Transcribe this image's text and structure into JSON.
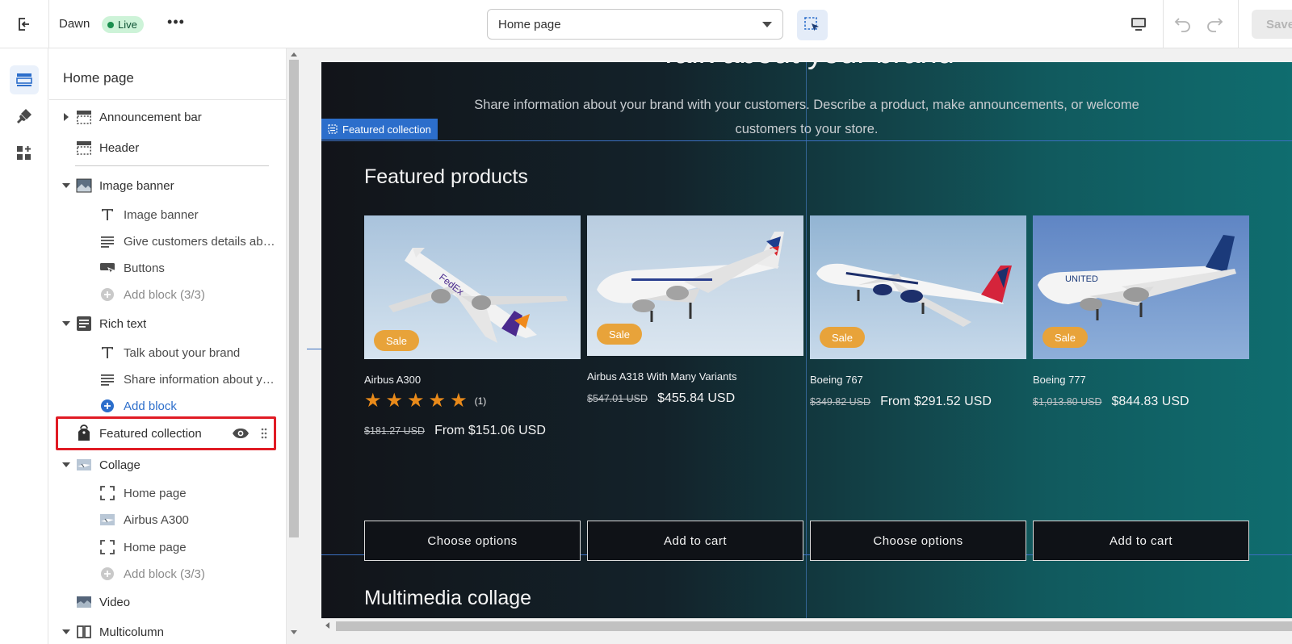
{
  "topbar": {
    "theme_name": "Dawn",
    "live_label": "Live",
    "more_label": "•••",
    "page_select": "Home page",
    "save_label": "Save"
  },
  "sidebar": {
    "title": "Home page",
    "items": [
      {
        "label": "Announcement bar",
        "icon": "announcement-bar-icon"
      },
      {
        "label": "Header",
        "icon": "header-icon"
      },
      {
        "label": "Image banner",
        "icon": "image-banner-icon"
      },
      {
        "label": "Image banner",
        "icon": "text-icon"
      },
      {
        "label": "Give customers details about the banner image(s) or content on the template.",
        "icon": "paragraph-icon"
      },
      {
        "label": "Buttons",
        "icon": "buttons-icon"
      },
      {
        "label": "Add block (3/3)",
        "icon": "add-circle-icon"
      },
      {
        "label": "Rich text",
        "icon": "rich-text-icon"
      },
      {
        "label": "Talk about your brand",
        "icon": "text-icon"
      },
      {
        "label": "Share information about your brand with your customers.",
        "icon": "paragraph-icon"
      },
      {
        "label": "Add block",
        "icon": "add-circle-icon"
      },
      {
        "label": "Featured collection",
        "icon": "tag-icon"
      },
      {
        "label": "Collage",
        "icon": "collage-icon"
      },
      {
        "label": "Home page",
        "icon": "frame-icon"
      },
      {
        "label": "Airbus A300",
        "icon": "product-thumb-icon"
      },
      {
        "label": "Home page",
        "icon": "frame-icon"
      },
      {
        "label": "Add block (3/3)",
        "icon": "add-circle-icon"
      },
      {
        "label": "Video",
        "icon": "video-icon"
      },
      {
        "label": "Multicolumn",
        "icon": "multicolumn-icon"
      }
    ]
  },
  "preview": {
    "brand_heading": "Talk about your brand",
    "brand_text": "Share information about your brand with your customers. Describe a product, make announcements, or welcome customers to your store.",
    "section_label": "Featured collection",
    "featured_title": "Featured products",
    "multimedia_title": "Multimedia collage",
    "products": [
      {
        "name": "Airbus A300",
        "sale": "Sale",
        "stars": "★",
        "review_count": "(1)",
        "old_price": "$181.27 USD",
        "new_price": "From $151.06 USD",
        "button": "Choose options"
      },
      {
        "name": "Airbus A318 With Many Variants",
        "sale": "Sale",
        "old_price": "$547.01 USD",
        "new_price": "$455.84 USD",
        "button": "Add to cart"
      },
      {
        "name": "Boeing 767",
        "sale": "Sale",
        "old_price": "$349.82 USD",
        "new_price": "From $291.52 USD",
        "button": "Choose options"
      },
      {
        "name": "Boeing 777",
        "sale": "Sale",
        "old_price": "$1,013.80 USD",
        "new_price": "$844.83 USD",
        "button": "Add to cart"
      }
    ]
  },
  "colors": {
    "accent": "#2c6ecb",
    "selection_outline": "#e01b24",
    "sale_badge": "#e8a33a",
    "star": "#e98a1a"
  }
}
